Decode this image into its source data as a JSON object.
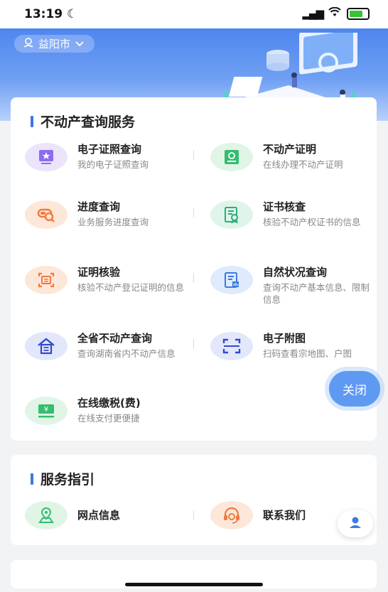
{
  "status_bar": {
    "time": "13:19",
    "signal": "•ıl",
    "wifi": "ᯤ"
  },
  "location": {
    "city": "益阳市"
  },
  "sections": {
    "query": {
      "title": "不动产查询服务",
      "items": [
        {
          "name": "电子证照查询",
          "desc": "我的电子证照查询",
          "icon": "certificate-icon",
          "color": "#ece4fb"
        },
        {
          "name": "不动产证明",
          "desc": "在线办理不动产证明",
          "icon": "property-cert-icon",
          "color": "#e0f5e6"
        },
        {
          "name": "进度查询",
          "desc": "业务服务进度查询",
          "icon": "progress-search-icon",
          "color": "#fde7d9"
        },
        {
          "name": "证书核查",
          "desc": "核验不动产权证书的信息",
          "icon": "cert-verify-icon",
          "color": "#dff5ea"
        },
        {
          "name": "证明核验",
          "desc": "核验不动产登记证明的信息",
          "icon": "proof-verify-icon",
          "color": "#fde7d9"
        },
        {
          "name": "自然状况查询",
          "desc": "查询不动产基本信息、限制信息",
          "icon": "status-doc-icon",
          "color": "#dfeafc"
        },
        {
          "name": "全省不动产查询",
          "desc": "查询湖南省内不动产信息",
          "icon": "house-icon",
          "color": "#e3e7fb"
        },
        {
          "name": "电子附图",
          "desc": "扫码查看宗地图、户图",
          "icon": "scan-icon",
          "color": "#e3e7fb"
        },
        {
          "name": "在线缴税(费)",
          "desc": "在线支付更便捷",
          "icon": "tax-pay-icon",
          "color": "#e0f5e6"
        }
      ]
    },
    "guide": {
      "title": "服务指引",
      "items": [
        {
          "name": "网点信息",
          "icon": "location-icon",
          "color": "#e0f5e6"
        },
        {
          "name": "联系我们",
          "icon": "headset-icon",
          "color": "#fde7d9"
        }
      ]
    }
  },
  "fab": {
    "close_label": "关闭"
  }
}
